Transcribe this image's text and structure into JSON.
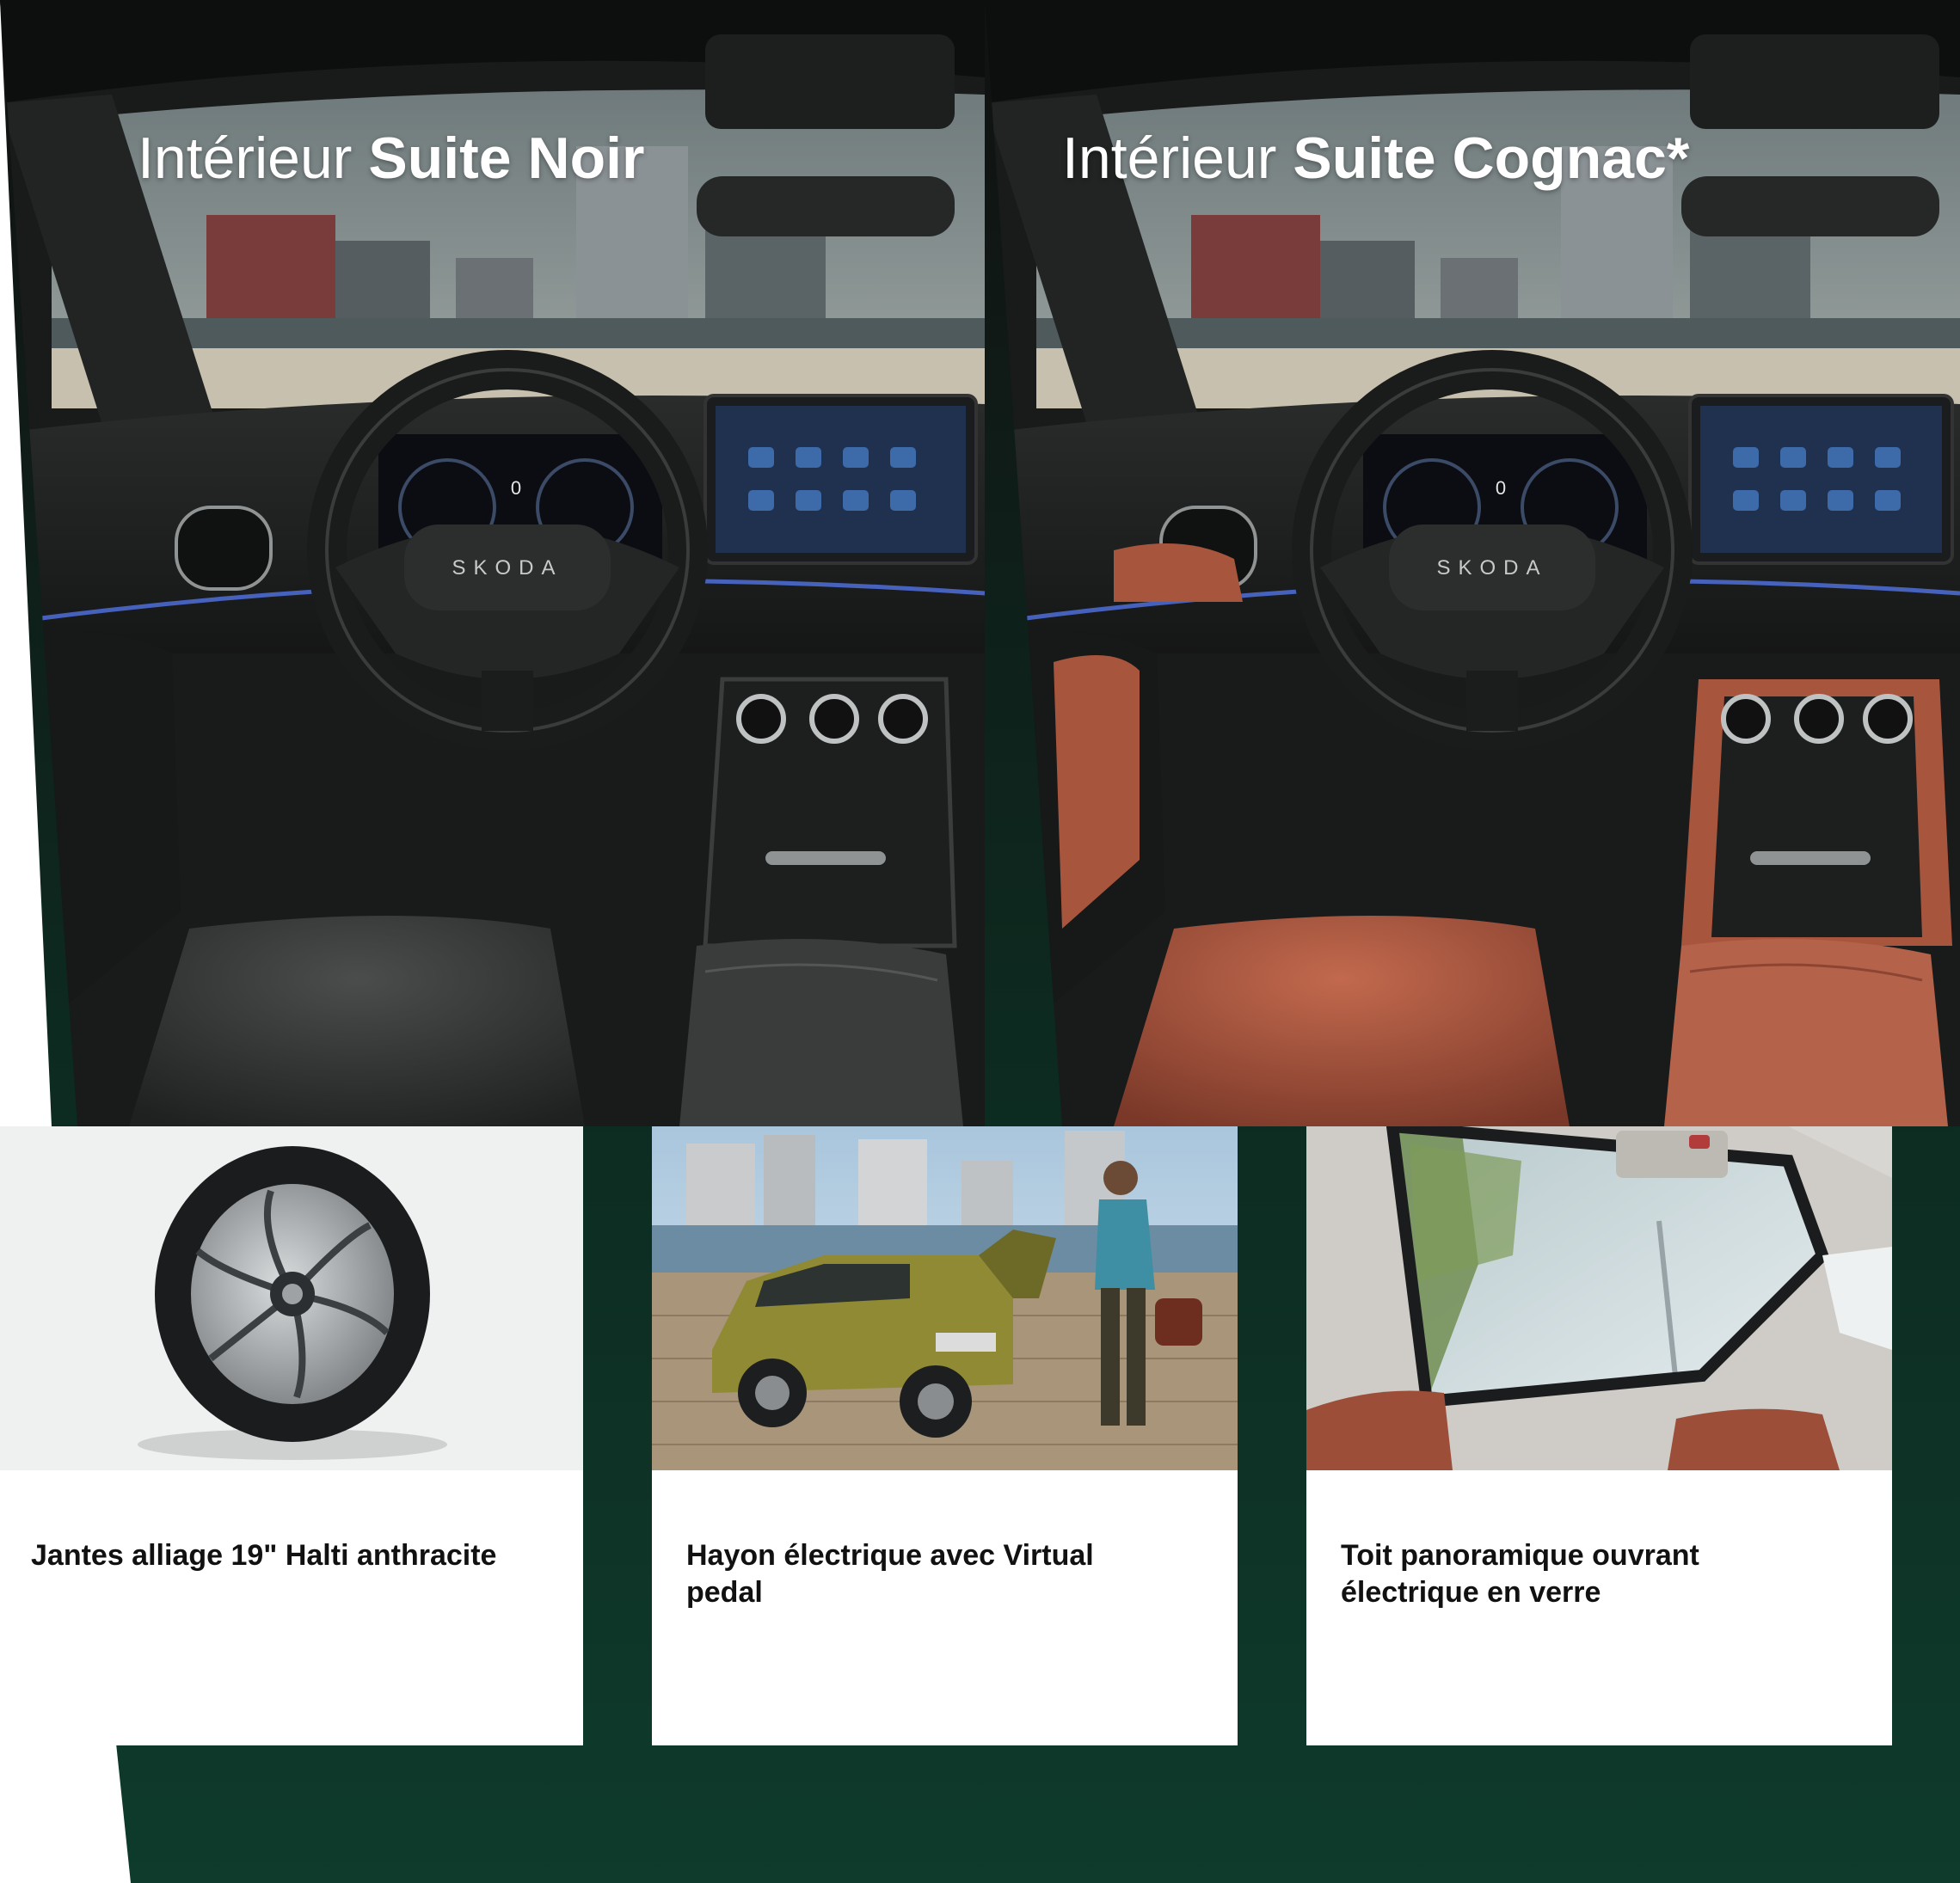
{
  "colors": {
    "band": "#0e3b2c",
    "band_dark": "#0a2e22",
    "cognac": "#a8553e",
    "noir_leather": "#2b2d2c",
    "ambient": "#4f6fd8"
  },
  "interiors": [
    {
      "title_light": "Intérieur",
      "title_bold": "Suite Noir",
      "steering_brand": "SKODA",
      "speed_readout": "0"
    },
    {
      "title_light": "Intérieur",
      "title_bold": "Suite Cognac*",
      "steering_brand": "SKODA",
      "speed_readout": "0"
    }
  ],
  "features": [
    {
      "caption": "Jantes alliage 19\" Halti anthracite",
      "image": "alloy-wheel"
    },
    {
      "caption": "Hayon électrique avec Virtual pedal",
      "image": "tailgate-suv"
    },
    {
      "caption": "Toit panoramique ouvrant électrique en verre",
      "image": "panoramic-roof"
    }
  ]
}
